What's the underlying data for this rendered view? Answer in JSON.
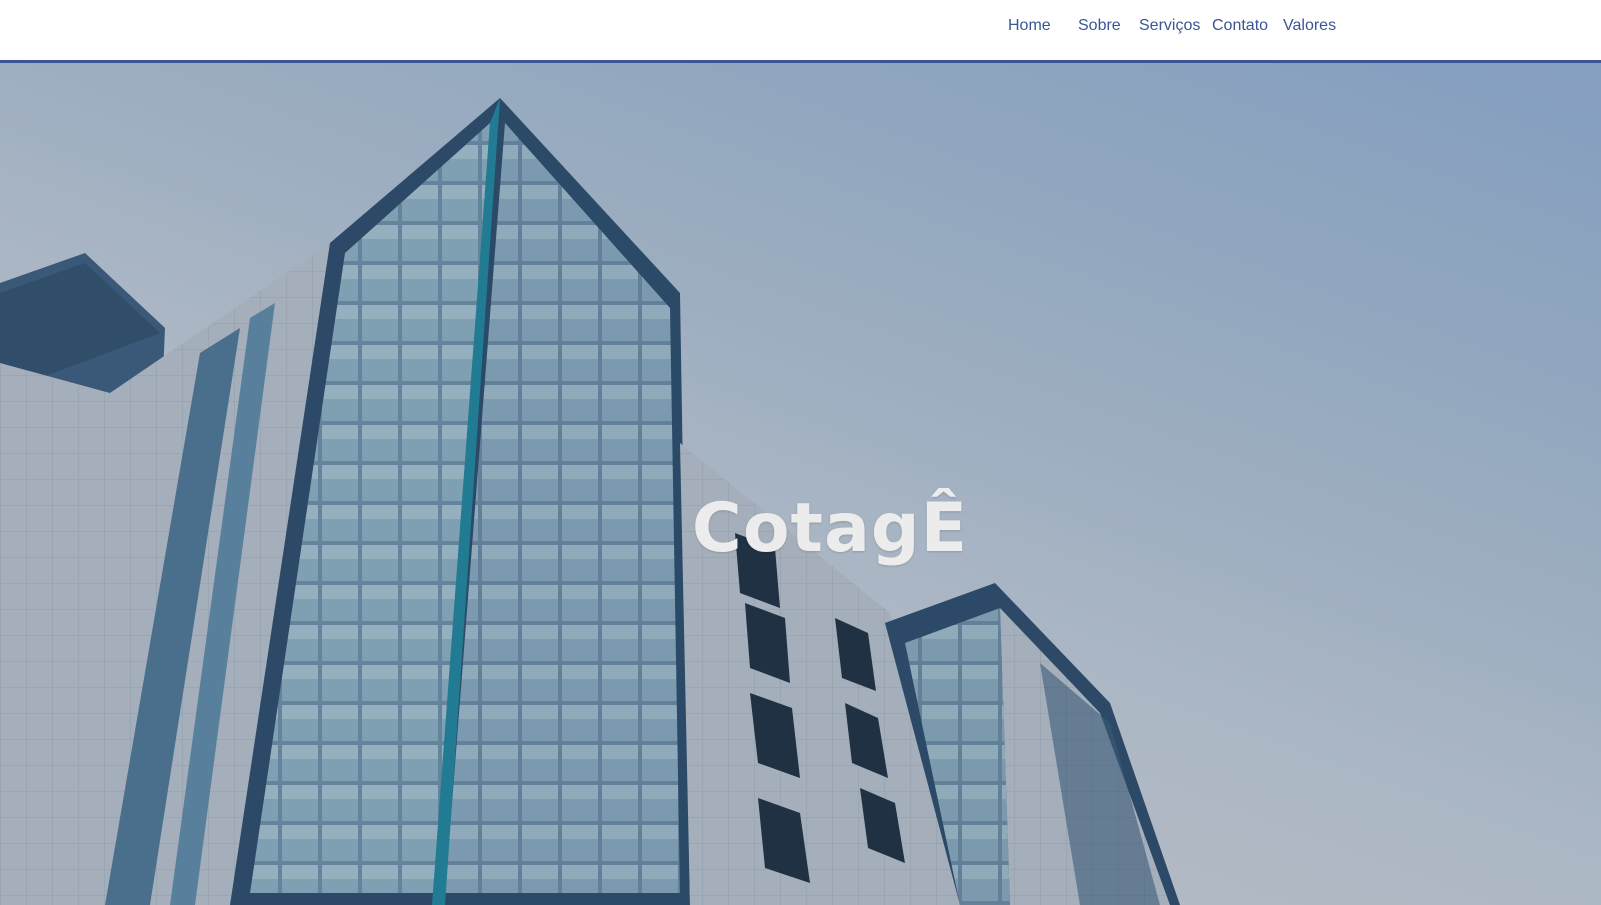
{
  "nav": {
    "items": [
      {
        "label": "Home"
      },
      {
        "label": "Sobre"
      },
      {
        "label": "Serviços"
      },
      {
        "label": "Contato"
      },
      {
        "label": "Valores"
      }
    ]
  },
  "hero": {
    "title": "CotagÊ"
  },
  "colors": {
    "accent": "#3a5694",
    "title": "#ececec"
  }
}
